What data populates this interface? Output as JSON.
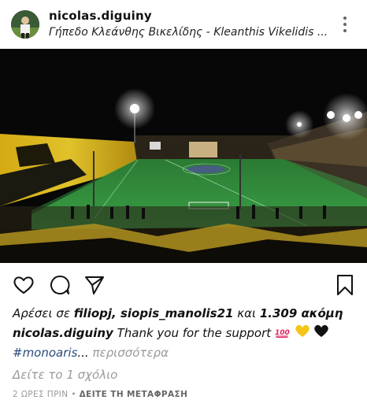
{
  "post": {
    "username": "nicolas.diguiny",
    "location": "Γήπεδο Κλεάνθης Βικελίδης - Kleanthis Vikelidis ...",
    "likes": {
      "prefix": "Αρέσει σε",
      "users": "filiopj, siopis_manolis21",
      "middle": "και",
      "count": "1.309 ακόμη"
    },
    "caption": {
      "username": "nicolas.diguiny",
      "text": "Thank you for the support",
      "emojis": [
        "100-emoji-icon",
        "yellow-heart-icon",
        "black-heart-icon"
      ],
      "hashtag": "#monoaris",
      "ellipsis": "...",
      "more": "περισσότερα"
    },
    "view_comments": "Δείτε το 1 σχόλιο",
    "time": "2 ΩΡΕΣ ΠΡΙΝ",
    "separator": "•",
    "translate": "ΔΕΙΤΕ ΤΗ ΜΕΤΑΦΡΑΣΗ"
  },
  "icons": {
    "like": "heart-icon",
    "comment": "comment-icon",
    "share": "send-icon",
    "save": "bookmark-icon",
    "more": "more-options-icon"
  },
  "colors": {
    "hashtag": "#2a4a7a",
    "muted": "#999999",
    "pitch": "#2f8a3a",
    "fans_yellow": "#d9b21a"
  }
}
